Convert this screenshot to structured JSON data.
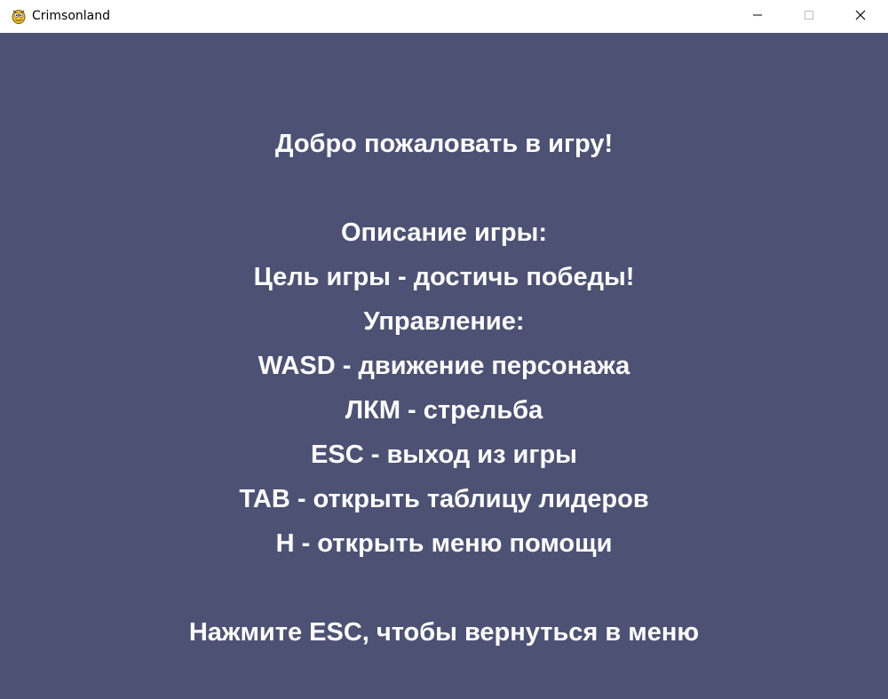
{
  "window": {
    "title": "Crimsonland",
    "icon": "pygame-snake-icon"
  },
  "controls": {
    "minimize_icon": "minimize-icon",
    "maximize_icon": "maximize-icon",
    "close_icon": "close-icon"
  },
  "colors": {
    "background": "#4d5173",
    "text": "#ffffff"
  },
  "help_screen": {
    "welcome": "Добро пожаловать в игру!",
    "description_header": "Описание игры:",
    "goal": "Цель игры - достичь победы!",
    "controls_header": "Управление:",
    "controls": [
      "WASD - движение персонажа",
      "ЛКМ - стрельба",
      "ESC - выход из игры",
      "TAB - открыть таблицу лидеров",
      "H - открыть меню помощи"
    ],
    "footer": "Нажмите ESC, чтобы вернуться в меню"
  }
}
